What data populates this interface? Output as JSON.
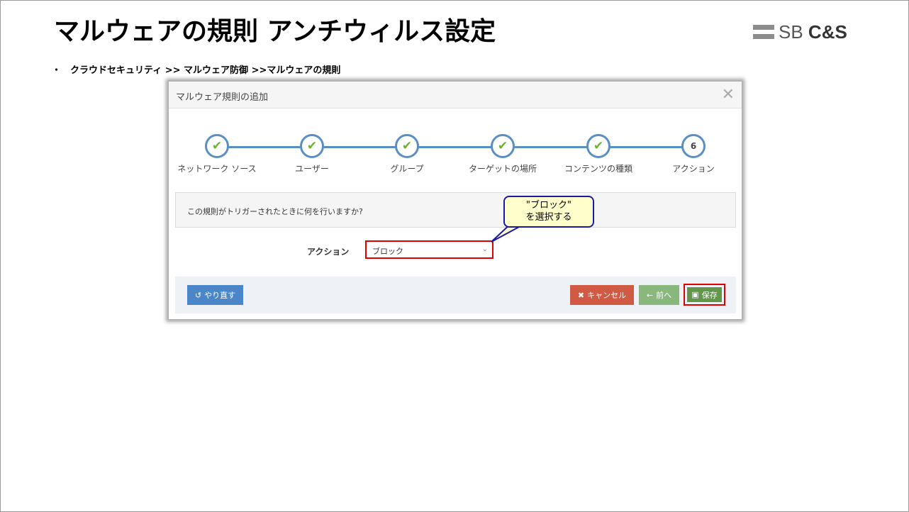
{
  "slide": {
    "title": "マルウェアの規則 アンチウィルス設定",
    "logo": {
      "sb": "SB",
      "cs": "C&S"
    },
    "breadcrumb": {
      "bullet": "・",
      "text": "クラウドセキュリティ >> マルウェア防御 >>マルウェアの規則"
    }
  },
  "modal": {
    "title": "マルウェア規則の追加",
    "close_icon": "close-icon",
    "steps": [
      {
        "label": "ネットワーク ソース",
        "state": "done",
        "icon": "check-icon"
      },
      {
        "label": "ユーザー",
        "state": "done",
        "icon": "check-icon"
      },
      {
        "label": "グループ",
        "state": "done",
        "icon": "check-icon"
      },
      {
        "label": "ターゲットの場所",
        "state": "done",
        "icon": "check-icon"
      },
      {
        "label": "コンテンツの種類",
        "state": "done",
        "icon": "check-icon"
      },
      {
        "label": "アクション",
        "state": "current",
        "number": "6"
      }
    ],
    "question": "この規則がトリガーされたときに何を行いますか?",
    "action_label": "アクション",
    "action_select": {
      "value": "ブロック",
      "icon": "chevron-down-icon"
    },
    "callout": {
      "line1": "\"ブロック\"",
      "line2": "を選択する"
    },
    "buttons": {
      "redo": {
        "label": "やり直す",
        "icon": "undo-icon"
      },
      "cancel": {
        "label": "キャンセル",
        "icon": "x-icon"
      },
      "prev": {
        "label": "前へ",
        "icon": "arrow-left-icon"
      },
      "save": {
        "label": "保存",
        "icon": "floppy-icon"
      }
    }
  },
  "colors": {
    "step_blue": "#5a8fc4",
    "check_green": "#6fb12c",
    "highlight_red": "#e00000",
    "redo_blue": "#4a86c8",
    "cancel_red": "#d05a44",
    "prev_green": "#88b87c",
    "save_green": "#62964a",
    "callout_fill": "#ffffcc",
    "callout_border": "#1a1aaa"
  }
}
